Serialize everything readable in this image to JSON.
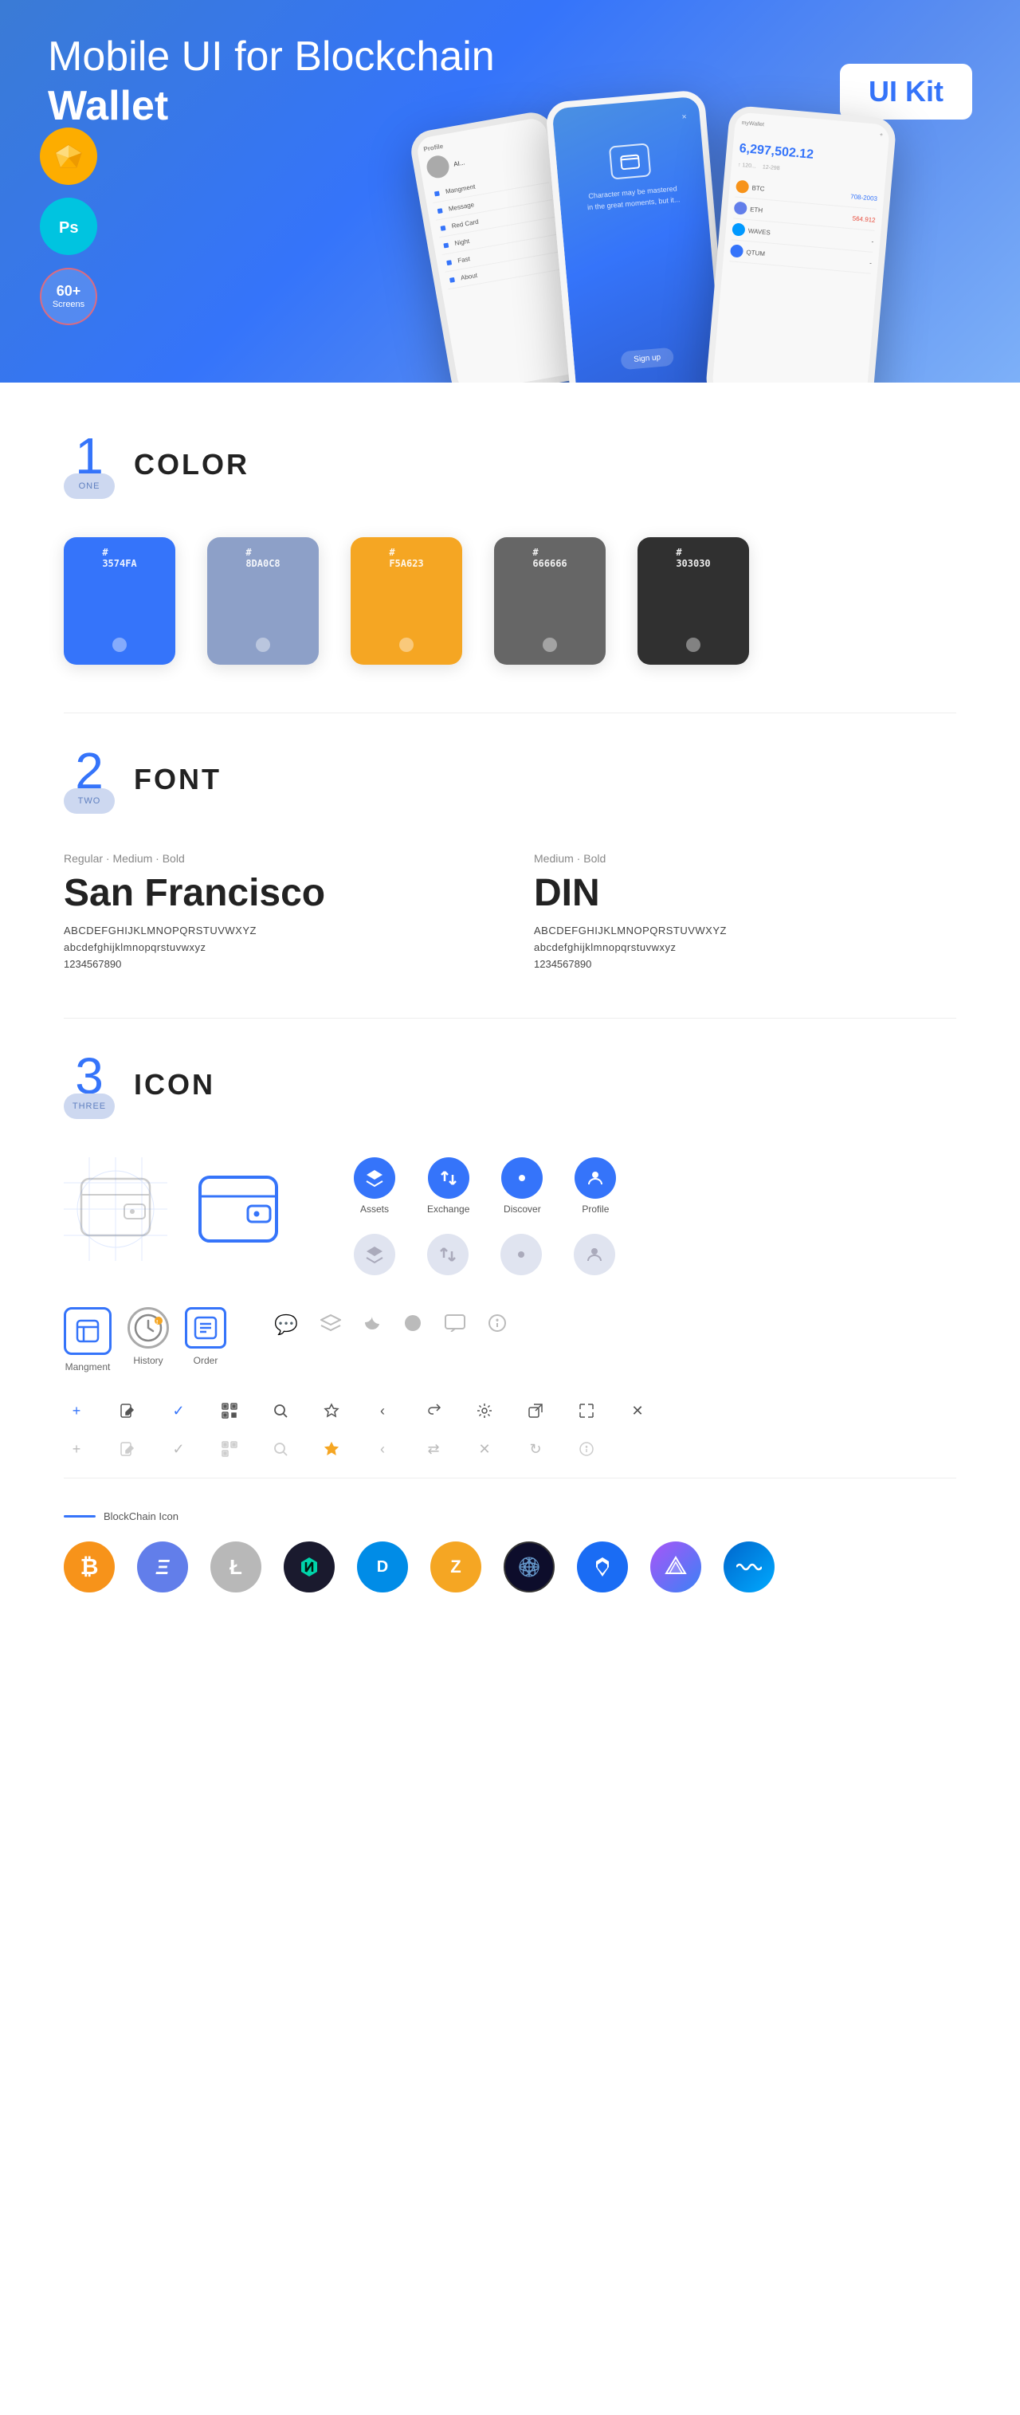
{
  "hero": {
    "title_regular": "Mobile UI for Blockchain ",
    "title_bold": "Wallet",
    "badge": "UI Kit",
    "sketch_label": "Sketch",
    "ps_label": "Photoshop",
    "screens_count": "60+",
    "screens_label": "Screens"
  },
  "colors": {
    "section_number": "1",
    "section_label": "ONE",
    "section_title": "COLOR",
    "swatches": [
      {
        "hex": "#3574FA",
        "label": "3574FA"
      },
      {
        "hex": "#8DA0C8",
        "label": "8DA0C8"
      },
      {
        "hex": "#F5A623",
        "label": "F5A623"
      },
      {
        "hex": "#666666",
        "label": "666666"
      },
      {
        "hex": "#303030",
        "label": "303030"
      }
    ]
  },
  "fonts": {
    "section_number": "2",
    "section_label": "TWO",
    "section_title": "FONT",
    "font1": {
      "weights": "Regular · Medium · Bold",
      "name": "San Francisco",
      "uppercase": "ABCDEFGHIJKLMNOPQRSTUVWXYZ",
      "lowercase": "abcdefghijklmnopqrstuvwxyz",
      "numbers": "1234567890"
    },
    "font2": {
      "weights": "Medium · Bold",
      "name": "DIN",
      "uppercase": "ABCDEFGHIJKLMNOPQRSTUVWXYZ",
      "lowercase": "abcdefghijklmnopqrstuvwxyz",
      "numbers": "1234567890"
    }
  },
  "icons": {
    "section_number": "3",
    "section_label": "THREE",
    "section_title": "ICON",
    "nav_items": [
      {
        "label": "Assets",
        "icon": "◆"
      },
      {
        "label": "Exchange",
        "icon": "⇄"
      },
      {
        "label": "Discover",
        "icon": "●"
      },
      {
        "label": "Profile",
        "icon": "◑"
      }
    ],
    "bottom_icons": [
      {
        "label": "Mangment",
        "icon": "▣"
      },
      {
        "label": "History",
        "icon": "◷"
      },
      {
        "label": "Order",
        "icon": "≡"
      }
    ]
  },
  "crypto": {
    "blockchain_label": "BlockChain Icon",
    "coins": [
      {
        "symbol": "₿",
        "name": "Bitcoin",
        "color": "#F7931A"
      },
      {
        "symbol": "Ξ",
        "name": "Ethereum",
        "color": "#627EEA"
      },
      {
        "symbol": "Ł",
        "name": "Litecoin",
        "color": "#B8B8B8"
      },
      {
        "symbol": "⟁",
        "name": "NULS",
        "color": "#1A1A2E"
      },
      {
        "symbol": "Đ",
        "name": "Dash",
        "color": "#008CE7"
      },
      {
        "symbol": "ℤ",
        "name": "Zcash",
        "color": "#F5A623"
      },
      {
        "symbol": "✦",
        "name": "Grid",
        "color": "#0D0D2B"
      },
      {
        "symbol": "▲",
        "name": "Lisk",
        "color": "#1A6CF4"
      },
      {
        "symbol": "◈",
        "name": "Prism",
        "color": "#6C3483"
      },
      {
        "symbol": "〜",
        "name": "Waves",
        "color": "#0099FF"
      }
    ]
  },
  "phone": {
    "amount": "6,297,502.12",
    "wallet_label": "myWallet",
    "crypto_items": [
      {
        "name": "BTC",
        "color": "#F7931A"
      },
      {
        "name": "ETH",
        "color": "#627EEA"
      },
      {
        "name": "WAVES",
        "color": "#0099FF"
      },
      {
        "name": "QTUM",
        "color": "#3574FA"
      }
    ]
  }
}
